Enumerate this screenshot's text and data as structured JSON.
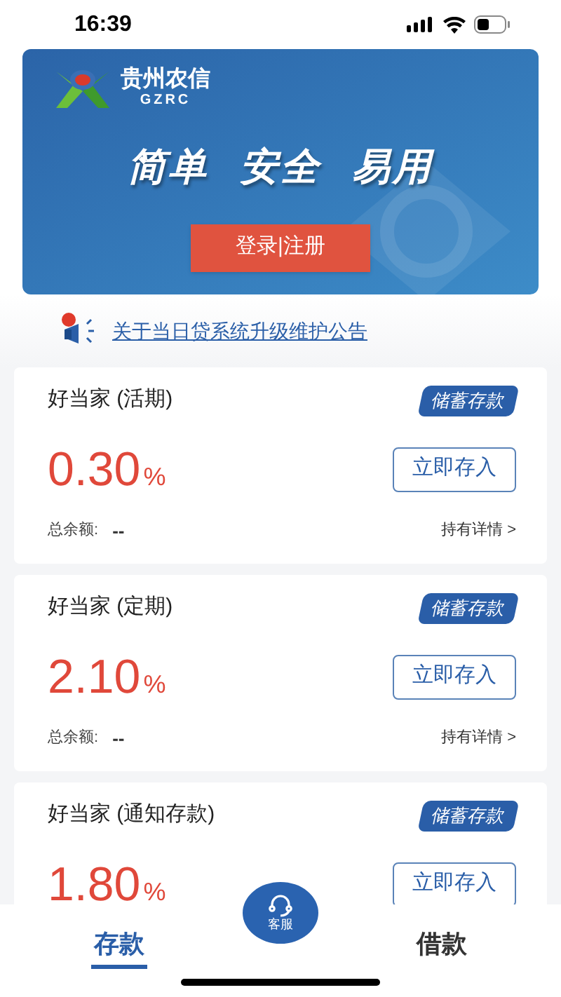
{
  "status_bar": {
    "time": "16:39"
  },
  "banner": {
    "brand": "贵州农信",
    "brand_sub": "GZRC",
    "slogan": [
      "简单",
      "安全",
      "易用"
    ],
    "login_button": "登录|注册"
  },
  "notice": {
    "text": "关于当日贷系统升级维护公告"
  },
  "products": [
    {
      "name": "好当家 (活期)",
      "tag": "储蓄存款",
      "rate": "0.30",
      "unit": "%",
      "button": "立即存入",
      "balance_label": "总余额:",
      "balance": "--",
      "details": "持有详情 >"
    },
    {
      "name": "好当家 (定期)",
      "tag": "储蓄存款",
      "rate": "2.10",
      "unit": "%",
      "button": "立即存入",
      "balance_label": "总余额:",
      "balance": "--",
      "details": "持有详情 >"
    },
    {
      "name": "好当家 (通知存款)",
      "tag": "储蓄存款",
      "rate": "1.80",
      "unit": "%",
      "button": "立即存入"
    }
  ],
  "tabs": [
    {
      "label": "存款",
      "selected": true
    },
    {
      "label": "借款",
      "selected": false
    }
  ],
  "service_button": {
    "label": "客服"
  }
}
